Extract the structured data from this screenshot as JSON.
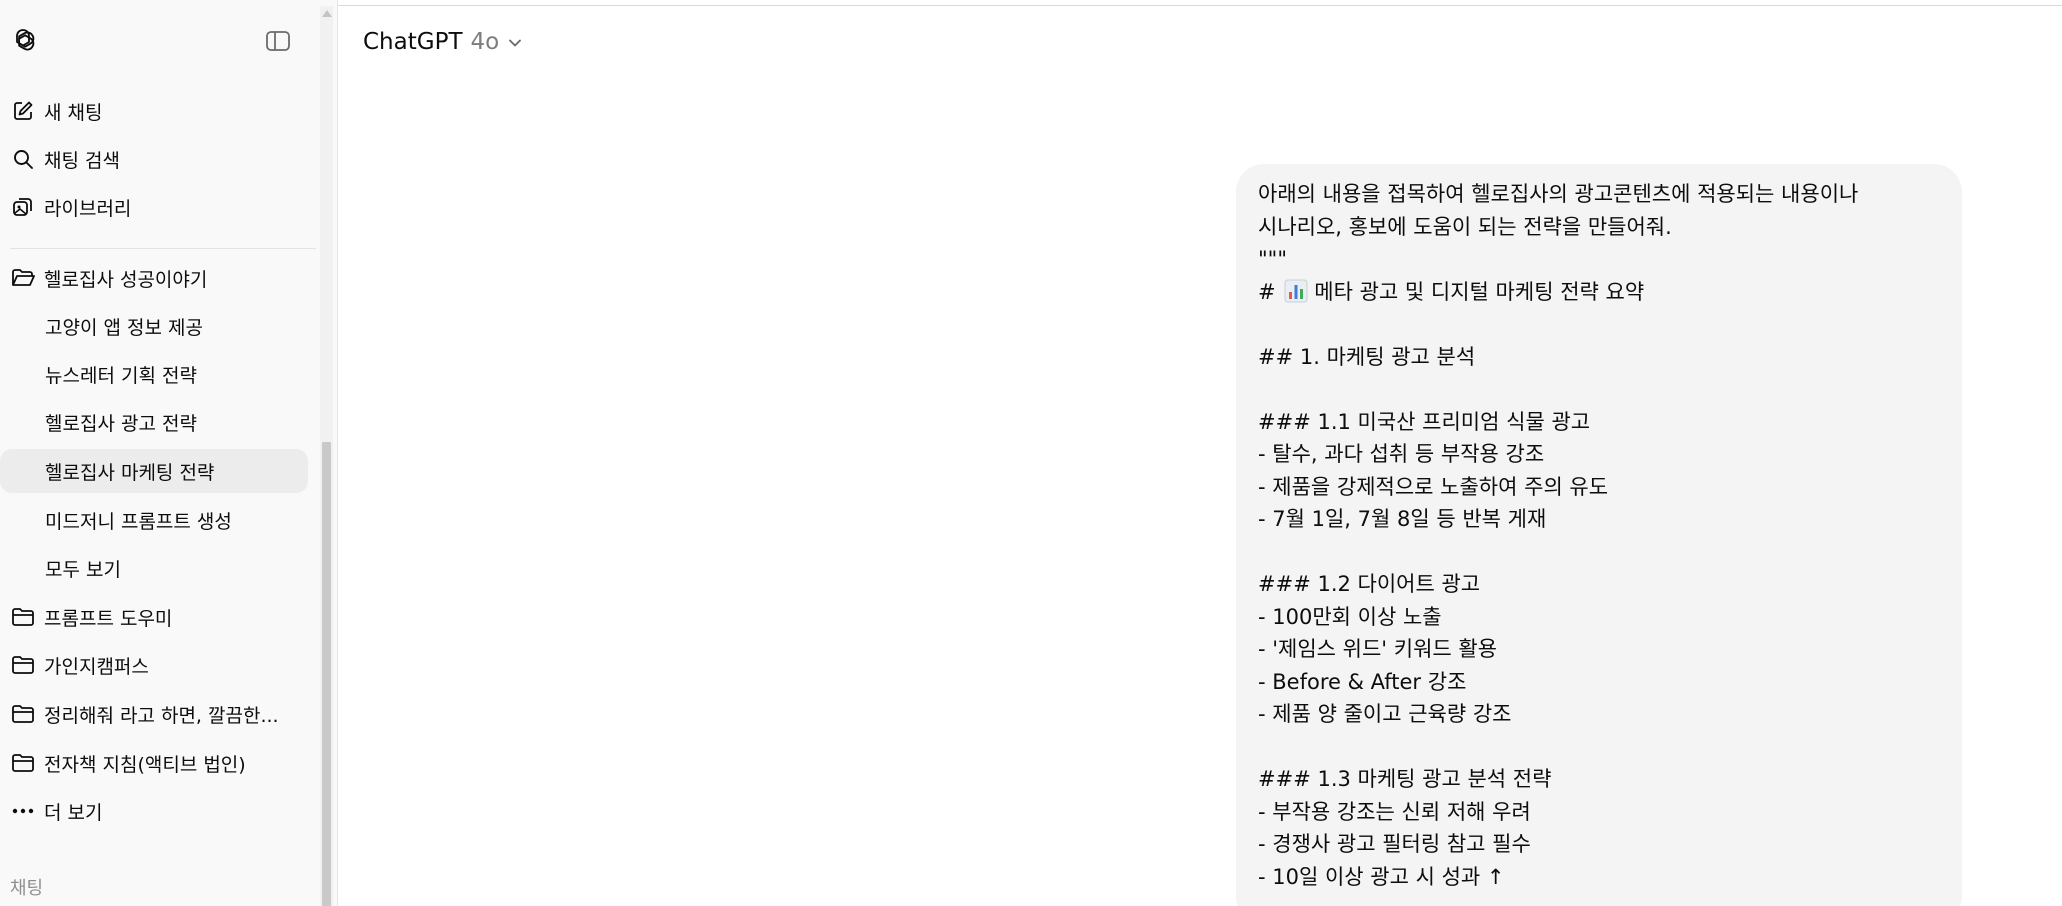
{
  "app": {
    "model_name": "ChatGPT",
    "model_version": "4o"
  },
  "sidebar": {
    "actions": [
      {
        "label": "새 채팅",
        "icon": "new-chat-icon"
      },
      {
        "label": "채팅 검색",
        "icon": "search-icon"
      },
      {
        "label": "라이브러리",
        "icon": "library-icon"
      }
    ],
    "projects": [
      {
        "label": "헬로집사 성공이야기",
        "icon": "folder-open-icon"
      },
      {
        "label": "프롬프트 도우미",
        "icon": "folder-icon"
      },
      {
        "label": "가인지캠퍼스",
        "icon": "folder-icon"
      },
      {
        "label": "정리해줘 라고 하면, 깔끔한...",
        "icon": "folder-icon"
      },
      {
        "label": "전자책 지침(액티브 법인)",
        "icon": "folder-icon"
      }
    ],
    "project_chats": [
      {
        "label": "고양이 앱 정보 제공",
        "active": false
      },
      {
        "label": "뉴스레터 기획 전략",
        "active": false
      },
      {
        "label": "헬로집사 광고 전략",
        "active": false
      },
      {
        "label": "헬로집사 마케팅 전략",
        "active": true
      },
      {
        "label": "미드저니 프롬프트 생성",
        "active": false
      },
      {
        "label": "모두 보기",
        "active": false
      }
    ],
    "more": {
      "label": "더 보기",
      "icon": "more-icon"
    },
    "section_label": "채팅"
  },
  "message": {
    "lines": [
      "아래의 내용을 접목하여 헬로집사의 광고콘텐츠에 적용되는 내용이나",
      "시나리오, 홍보에 도움이 되는 전략을 만들어줘.",
      "\"\"\"",
      "메타 광고 및 디지털 마케팅 전략 요약",
      "",
      "## 1. 마케팅 광고 분석",
      "",
      "### 1.1 미국산 프리미엄 식물 광고",
      "- 탈수, 과다 섭취 등 부작용 강조",
      "- 제품을 강제적으로 노출하여 주의 유도",
      "- 7월 1일, 7월 8일 등 반복 게재",
      "",
      "### 1.2 다이어트 광고",
      "- 100만회 이상 노출",
      "- '제임스 위드' 키워드 활용",
      "- Before & After 강조",
      "- 제품 양 줄이고 근육량 강조",
      "",
      "### 1.3 마케팅 광고 분석 전략",
      "- 부작용 강조는 신뢰 저해 우려",
      "- 경쟁사 광고 필터링 참고 필수",
      "- 10일 이상 광고 시 성과 ↑"
    ],
    "heading_prefix": "#",
    "heading_icon": "bar-chart-emoji-icon"
  }
}
